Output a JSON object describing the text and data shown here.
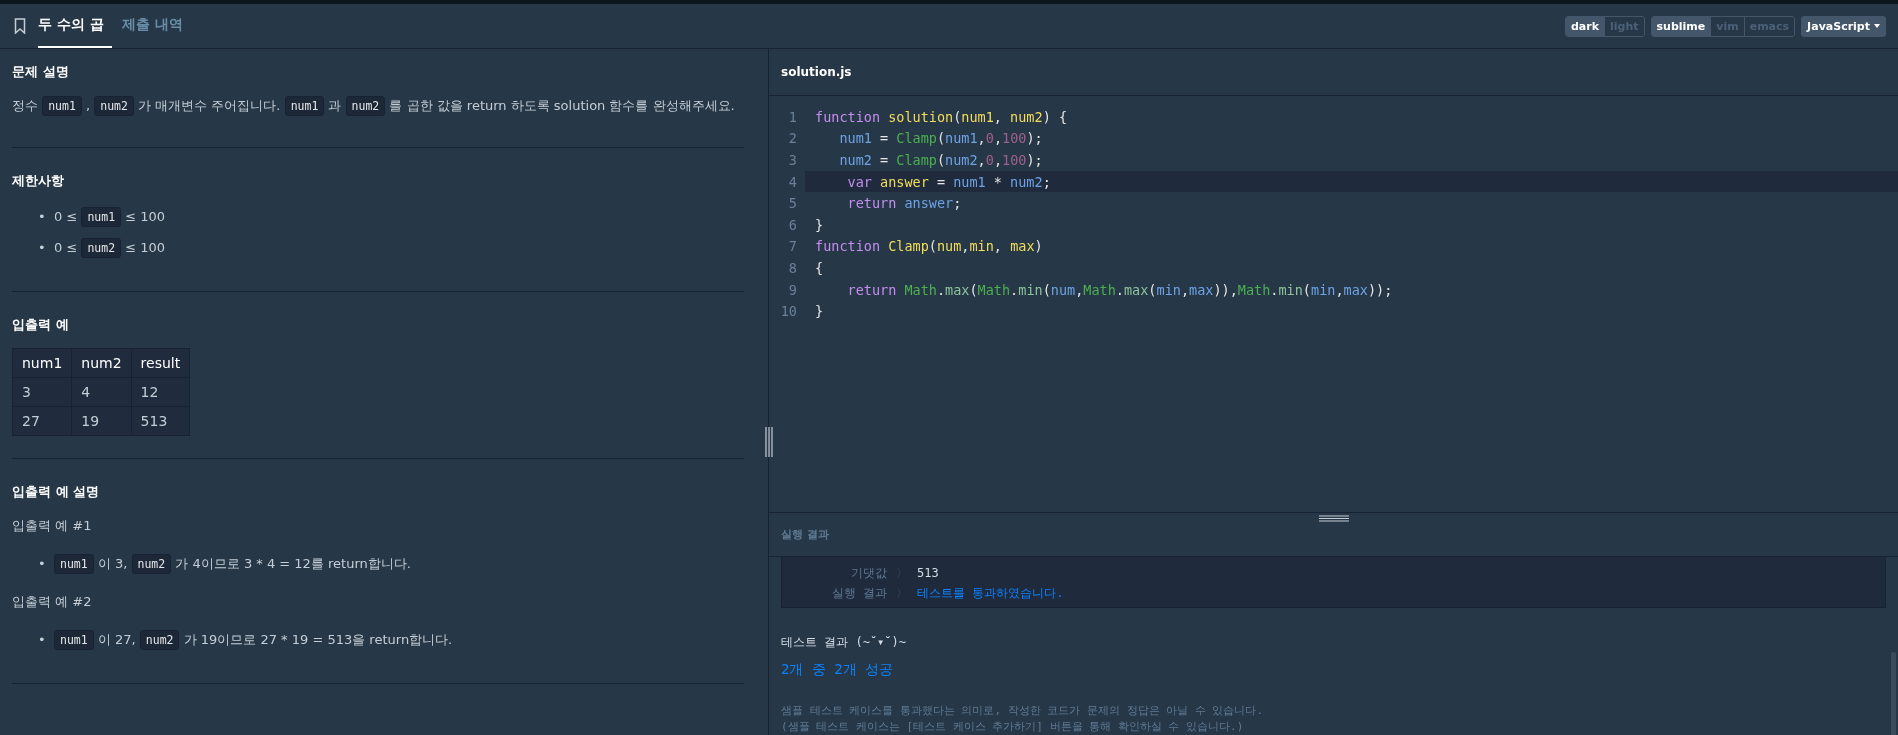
{
  "tabs": [
    {
      "label": "두 수의 곱",
      "selected": true
    },
    {
      "label": "제출 내역",
      "selected": false
    }
  ],
  "toggle_groups": [
    {
      "options": [
        {
          "label": "dark",
          "selected": true
        },
        {
          "label": "light",
          "selected": false
        }
      ]
    },
    {
      "options": [
        {
          "label": "sublime",
          "selected": true
        },
        {
          "label": "vim",
          "selected": false
        },
        {
          "label": "emacs",
          "selected": false
        }
      ]
    }
  ],
  "language_dropdown": {
    "value": "JavaScript"
  },
  "problem": {
    "sections": [
      {
        "heading": "문제 설명",
        "blocks": [
          {
            "kind": "paragraph",
            "segments": [
              {
                "kind": "text",
                "text": "정수 "
              },
              {
                "kind": "code",
                "text": "num1"
              },
              {
                "kind": "text",
                "text": " , "
              },
              {
                "kind": "code",
                "text": "num2"
              },
              {
                "kind": "text",
                "text": " 가 매개변수 주어집니다. "
              },
              {
                "kind": "code",
                "text": "num1"
              },
              {
                "kind": "text",
                "text": " 과 "
              },
              {
                "kind": "code",
                "text": "num2"
              },
              {
                "kind": "text",
                "text": " 를 곱한 값을 return 하도록 solution 함수를 완성해주세요."
              }
            ]
          }
        ]
      },
      {
        "heading": "제한사항",
        "blocks": [
          {
            "kind": "bullets",
            "items": [
              {
                "marker": "•",
                "segments": [
                  {
                    "kind": "text",
                    "text": "0 ≤ "
                  },
                  {
                    "kind": "code",
                    "text": "num1"
                  },
                  {
                    "kind": "text",
                    "text": " ≤ 100"
                  }
                ]
              },
              {
                "marker": "•",
                "segments": [
                  {
                    "kind": "text",
                    "text": "0 ≤ "
                  },
                  {
                    "kind": "code",
                    "text": "num2"
                  },
                  {
                    "kind": "text",
                    "text": " ≤ 100"
                  }
                ]
              }
            ]
          }
        ]
      },
      {
        "heading": "입출력 예",
        "blocks": [
          {
            "kind": "table",
            "columns": [
              "num1",
              "num2",
              "result"
            ],
            "rows": [
              [
                "3",
                "4",
                "12"
              ],
              [
                "27",
                "19",
                "513"
              ]
            ]
          }
        ]
      },
      {
        "heading": "입출력 예 설명",
        "blocks": [
          {
            "kind": "paragraph",
            "segments": [
              {
                "kind": "text",
                "text": "입출력 예 #1"
              }
            ]
          },
          {
            "kind": "bullets",
            "items": [
              {
                "marker": "•",
                "segments": [
                  {
                    "kind": "code",
                    "text": "num1"
                  },
                  {
                    "kind": "text",
                    "text": " 이 3, "
                  },
                  {
                    "kind": "code",
                    "text": "num2"
                  },
                  {
                    "kind": "text",
                    "text": " 가 4이므로 3 * 4 = 12를 return합니다."
                  }
                ]
              }
            ]
          },
          {
            "kind": "paragraph",
            "segments": [
              {
                "kind": "text",
                "text": "입출력 예 #2"
              }
            ]
          },
          {
            "kind": "bullets",
            "items": [
              {
                "marker": "•",
                "segments": [
                  {
                    "kind": "code",
                    "text": "num1"
                  },
                  {
                    "kind": "text",
                    "text": " 이 27, "
                  },
                  {
                    "kind": "code",
                    "text": "num2"
                  },
                  {
                    "kind": "text",
                    "text": " 가 19이므로 27 * 19 = 513을 return합니다."
                  }
                ]
              }
            ]
          }
        ]
      }
    ]
  },
  "editor": {
    "filename": "solution.js",
    "lines": [
      {
        "number": "1",
        "highlighted": false,
        "tokens": [
          {
            "kind": "keyword",
            "text": "function "
          },
          {
            "kind": "name",
            "text": "solution"
          },
          {
            "kind": "plain",
            "text": "("
          },
          {
            "kind": "name",
            "text": "num1"
          },
          {
            "kind": "plain",
            "text": ", "
          },
          {
            "kind": "name",
            "text": "num2"
          },
          {
            "kind": "plain",
            "text": ") {"
          }
        ]
      },
      {
        "number": "2",
        "highlighted": false,
        "tokens": [
          {
            "kind": "variable",
            "text": "   num1"
          },
          {
            "kind": "plain",
            "text": " = "
          },
          {
            "kind": "call",
            "text": "Clamp"
          },
          {
            "kind": "plain",
            "text": "("
          },
          {
            "kind": "variable",
            "text": "num1"
          },
          {
            "kind": "plain",
            "text": ","
          },
          {
            "kind": "number",
            "text": "0"
          },
          {
            "kind": "plain",
            "text": ","
          },
          {
            "kind": "number",
            "text": "100"
          },
          {
            "kind": "plain",
            "text": ");"
          }
        ]
      },
      {
        "number": "3",
        "highlighted": false,
        "tokens": [
          {
            "kind": "variable",
            "text": "   num2"
          },
          {
            "kind": "plain",
            "text": " = "
          },
          {
            "kind": "call",
            "text": "Clamp"
          },
          {
            "kind": "plain",
            "text": "("
          },
          {
            "kind": "variable",
            "text": "num2"
          },
          {
            "kind": "plain",
            "text": ","
          },
          {
            "kind": "number",
            "text": "0"
          },
          {
            "kind": "plain",
            "text": ","
          },
          {
            "kind": "number",
            "text": "100"
          },
          {
            "kind": "plain",
            "text": ");"
          }
        ]
      },
      {
        "number": "4",
        "highlighted": true,
        "tokens": [
          {
            "kind": "keyword",
            "text": "    var "
          },
          {
            "kind": "name",
            "text": "answer"
          },
          {
            "kind": "plain",
            "text": " = "
          },
          {
            "kind": "variable",
            "text": "num1"
          },
          {
            "kind": "plain",
            "text": " * "
          },
          {
            "kind": "variable",
            "text": "num2"
          },
          {
            "kind": "plain",
            "text": ";"
          }
        ]
      },
      {
        "number": "5",
        "highlighted": false,
        "tokens": [
          {
            "kind": "keyword",
            "text": "    return "
          },
          {
            "kind": "variable",
            "text": "answer"
          },
          {
            "kind": "plain",
            "text": ";"
          }
        ]
      },
      {
        "number": "6",
        "highlighted": false,
        "tokens": [
          {
            "kind": "plain",
            "text": "}"
          }
        ]
      },
      {
        "number": "7",
        "highlighted": false,
        "tokens": [
          {
            "kind": "keyword",
            "text": "function "
          },
          {
            "kind": "name",
            "text": "Clamp"
          },
          {
            "kind": "plain",
            "text": "("
          },
          {
            "kind": "name",
            "text": "num"
          },
          {
            "kind": "plain",
            "text": ","
          },
          {
            "kind": "name",
            "text": "min"
          },
          {
            "kind": "plain",
            "text": ", "
          },
          {
            "kind": "name",
            "text": "max"
          },
          {
            "kind": "plain",
            "text": ")"
          }
        ]
      },
      {
        "number": "8",
        "highlighted": false,
        "tokens": [
          {
            "kind": "plain",
            "text": "{"
          }
        ]
      },
      {
        "number": "9",
        "highlighted": false,
        "tokens": [
          {
            "kind": "keyword",
            "text": "    return "
          },
          {
            "kind": "call",
            "text": "Math"
          },
          {
            "kind": "plain",
            "text": "."
          },
          {
            "kind": "method",
            "text": "max"
          },
          {
            "kind": "plain",
            "text": "("
          },
          {
            "kind": "call",
            "text": "Math"
          },
          {
            "kind": "plain",
            "text": "."
          },
          {
            "kind": "method",
            "text": "min"
          },
          {
            "kind": "plain",
            "text": "("
          },
          {
            "kind": "variable",
            "text": "num"
          },
          {
            "kind": "plain",
            "text": ","
          },
          {
            "kind": "call",
            "text": "Math"
          },
          {
            "kind": "plain",
            "text": "."
          },
          {
            "kind": "method",
            "text": "max"
          },
          {
            "kind": "plain",
            "text": "("
          },
          {
            "kind": "variable",
            "text": "min"
          },
          {
            "kind": "plain",
            "text": ","
          },
          {
            "kind": "variable",
            "text": "max"
          },
          {
            "kind": "plain",
            "text": ")),"
          },
          {
            "kind": "call",
            "text": "Math"
          },
          {
            "kind": "plain",
            "text": "."
          },
          {
            "kind": "method",
            "text": "min"
          },
          {
            "kind": "plain",
            "text": "("
          },
          {
            "kind": "variable",
            "text": "min"
          },
          {
            "kind": "plain",
            "text": ","
          },
          {
            "kind": "variable",
            "text": "max"
          },
          {
            "kind": "plain",
            "text": "));"
          }
        ]
      },
      {
        "number": "10",
        "highlighted": false,
        "tokens": [
          {
            "kind": "plain",
            "text": "}"
          }
        ]
      }
    ]
  },
  "results": {
    "title": "실행 결과",
    "case_rows": [
      {
        "label": "기댓값",
        "separator": "〉",
        "value": "513",
        "kind": "plain"
      },
      {
        "label": "실행 결과",
        "separator": "〉",
        "value": "테스트를 통과하였습니다.",
        "kind": "pass"
      }
    ],
    "summary_title": "테스트 결과 (~˘▾˘)~",
    "summary": "2개 중 2개 성공",
    "notes": [
      "샘플 테스트 케이스를 통과했다는 의미로, 작성한 코드가 문제의 정답은 아닐 수 있습니다.",
      "(샘플 테스트 케이스는 [테스트 케이스 추가하기] 버튼을 통해 확인하실 수 있습니다.)"
    ]
  }
}
